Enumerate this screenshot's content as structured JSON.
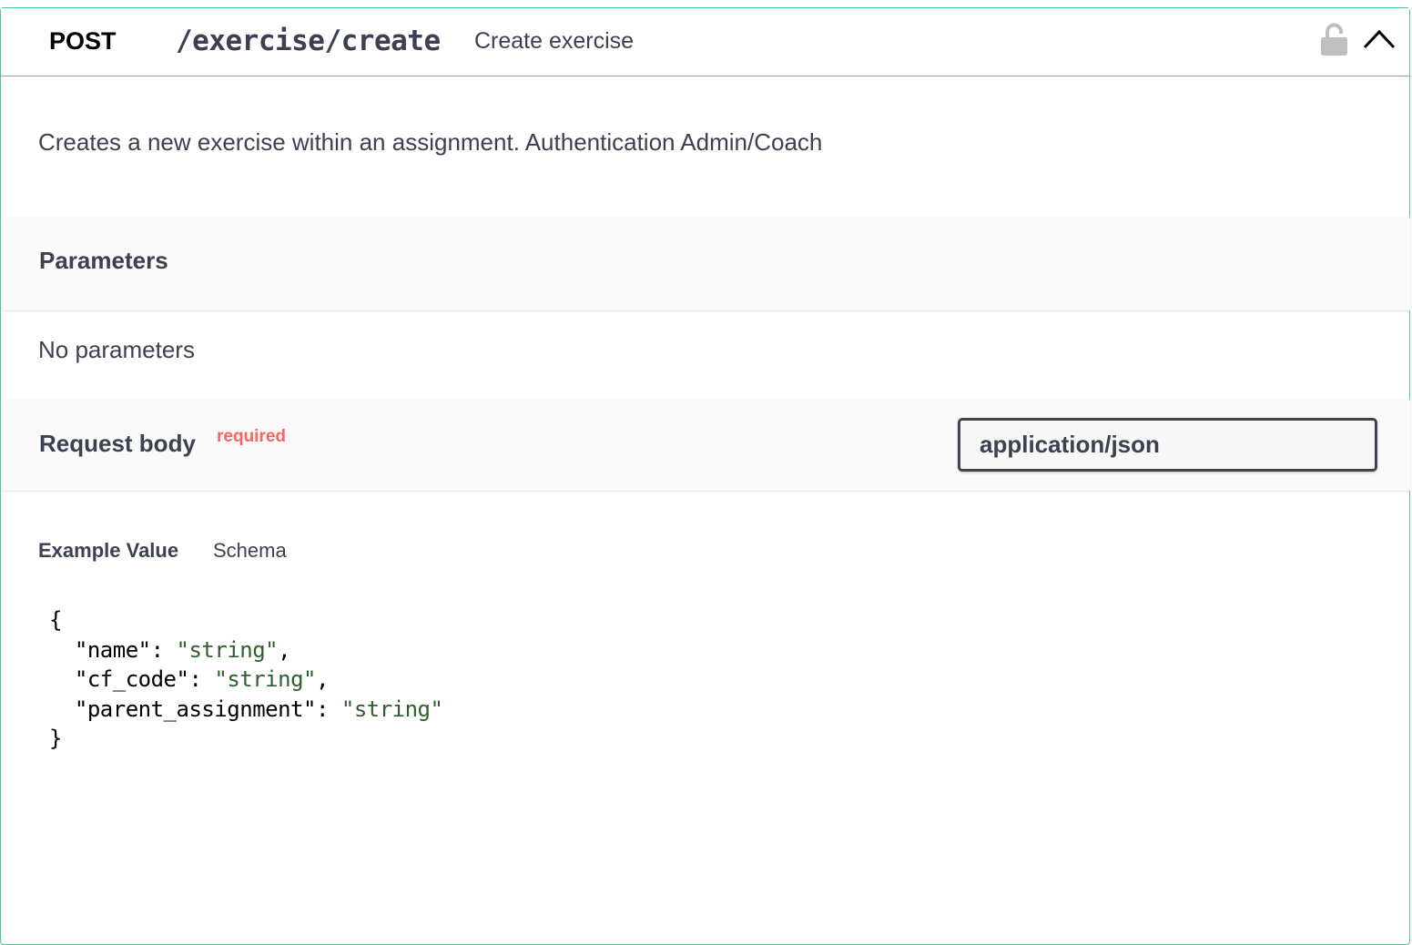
{
  "operation": {
    "method": "POST",
    "path": "/exercise/create",
    "summary": "Create exercise",
    "description": "Creates a new exercise within an assignment. Authentication Admin/Coach",
    "icons": {
      "lock": "unlocked-padlock-icon",
      "toggle": "chevron-up-icon"
    },
    "accent_color": "#49cc90"
  },
  "parameters": {
    "title": "Parameters",
    "empty_text": "No parameters"
  },
  "request_body": {
    "title": "Request body",
    "required_label": "required",
    "required_color": "#ff6060",
    "content_type": "application/json"
  },
  "example": {
    "tab_example_label": "Example Value",
    "tab_schema_label": "Schema",
    "json_fields": [
      {
        "key": "name",
        "value": "string"
      },
      {
        "key": "cf_code",
        "value": "string"
      },
      {
        "key": "parent_assignment",
        "value": "string"
      }
    ]
  }
}
